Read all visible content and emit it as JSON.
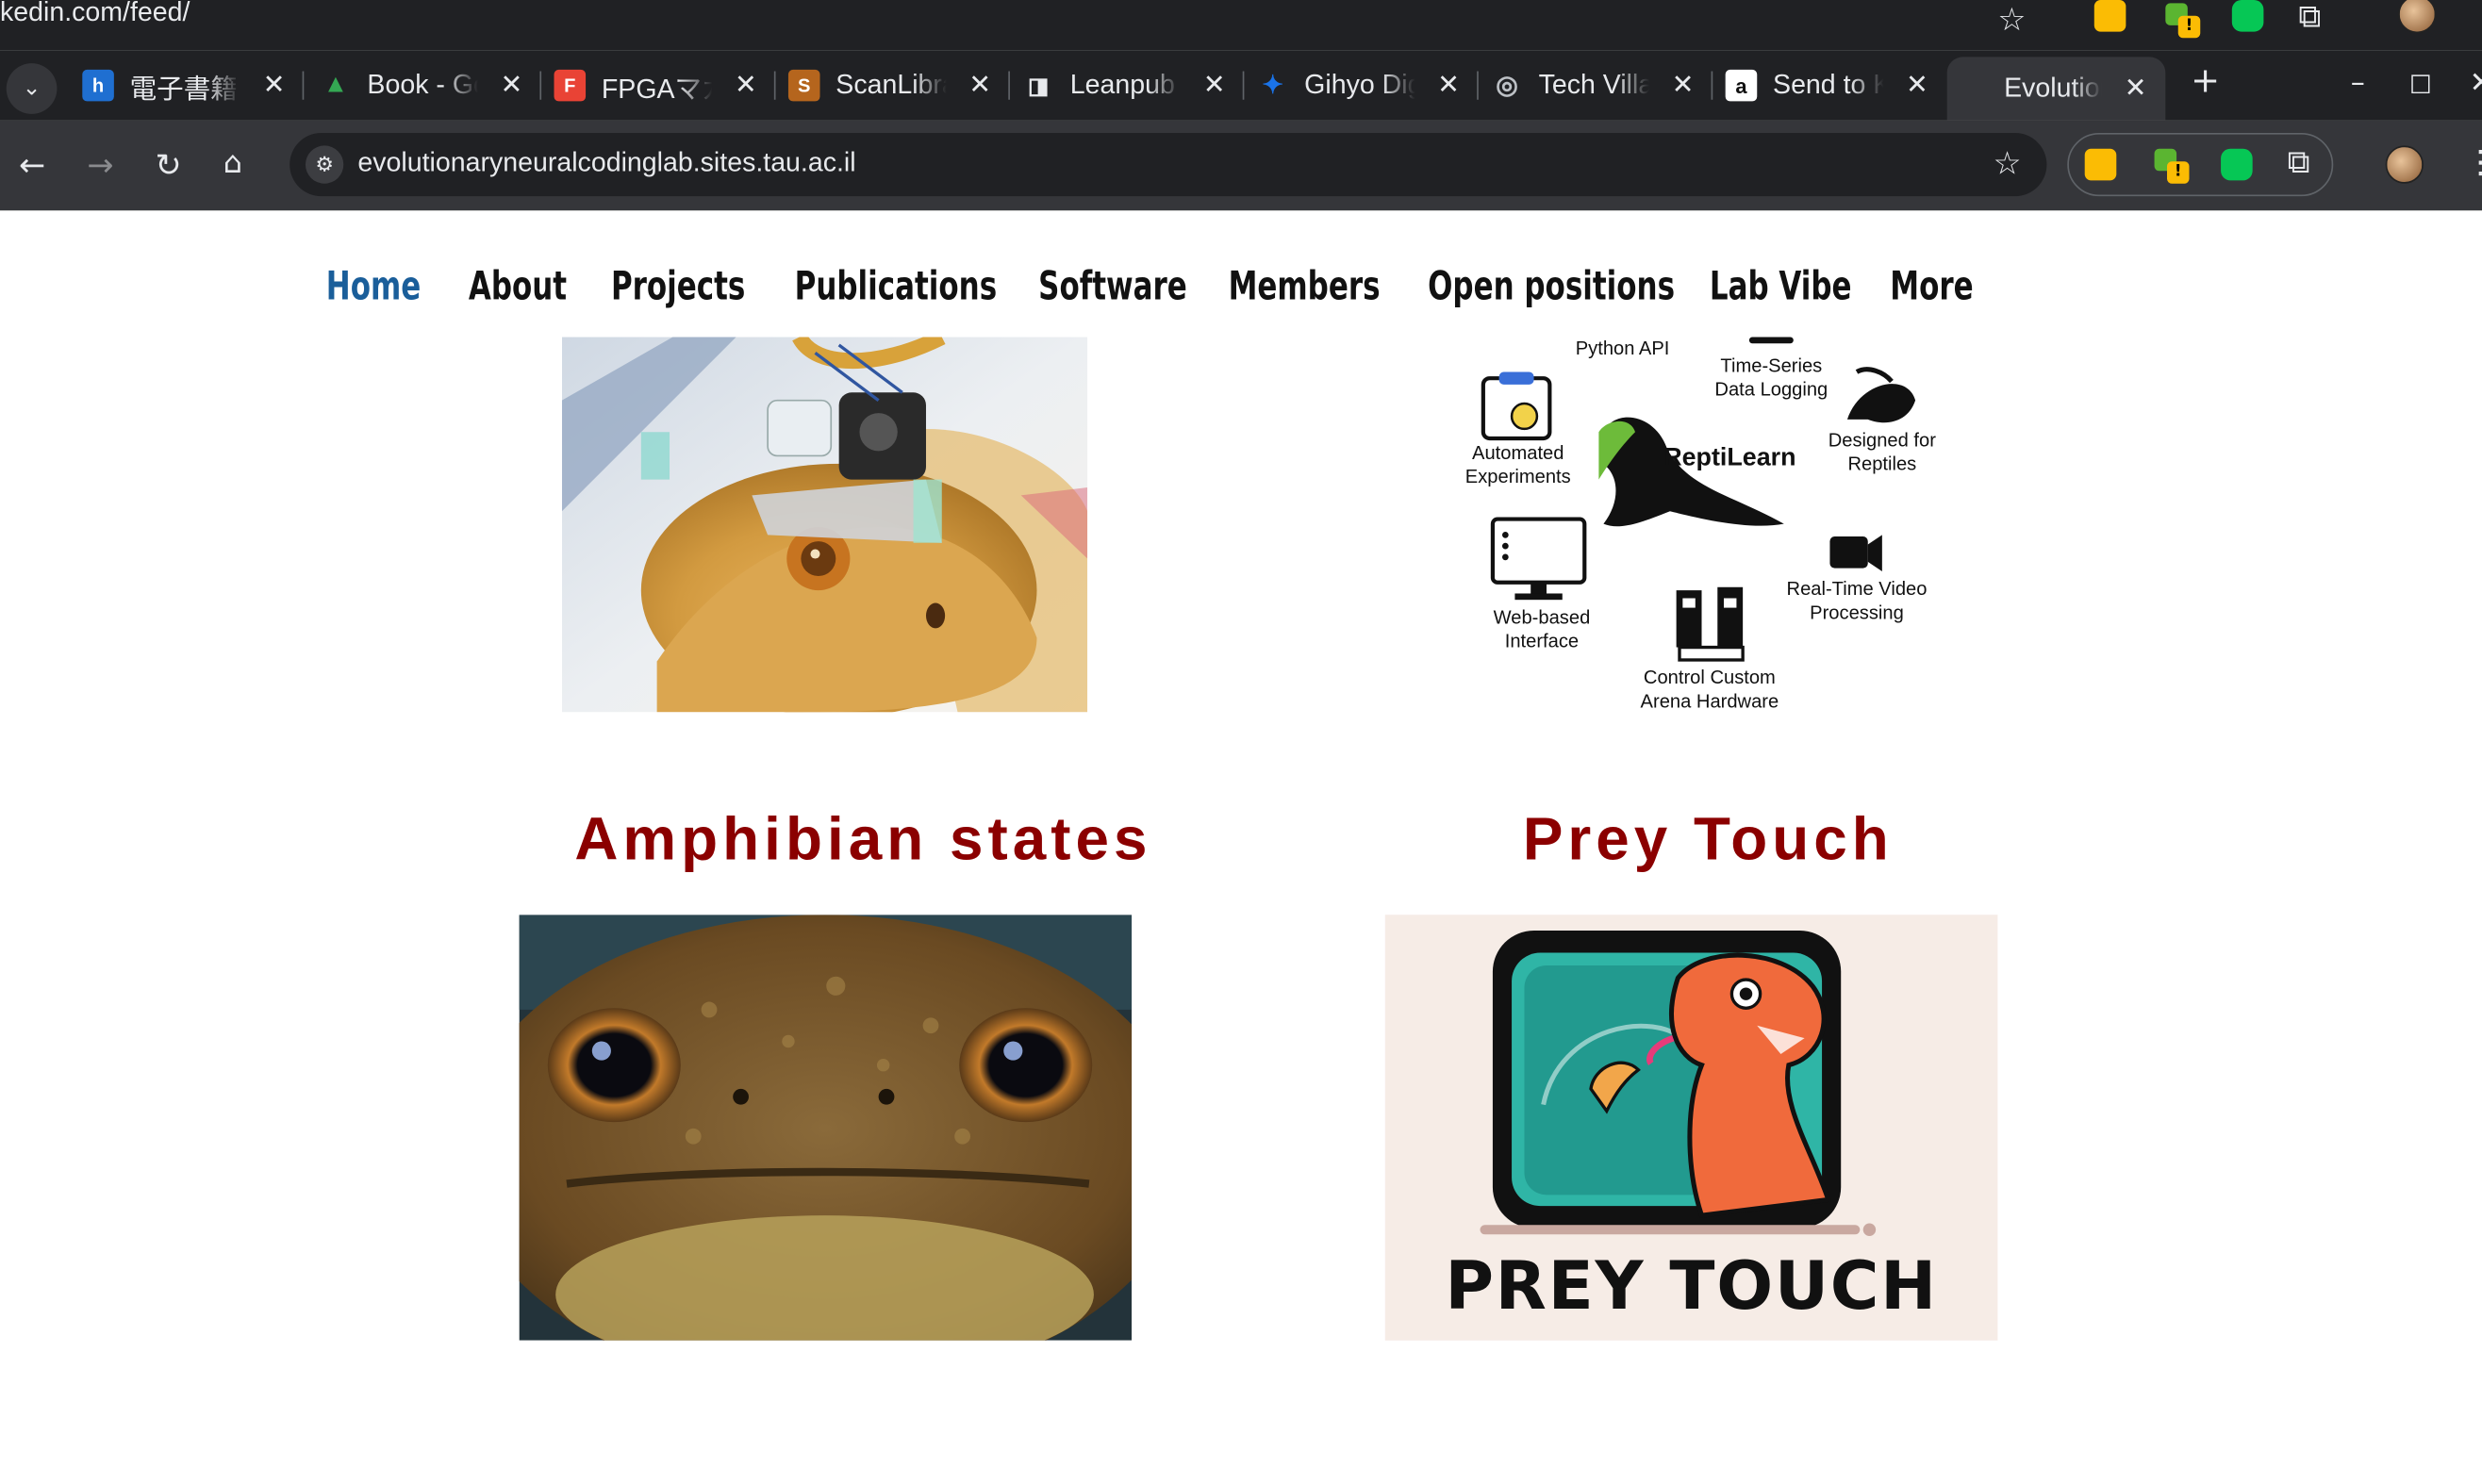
{
  "browser": {
    "prev_url": "kedin.com/feed/",
    "tabs": [
      {
        "title": "電子書籍",
        "favicon": "hatena-icon",
        "color": "#1f6fd1",
        "glyph": "h"
      },
      {
        "title": "Book - Google Drive",
        "favicon": "drive-icon",
        "color": "#34a853",
        "glyph": "▲"
      },
      {
        "title": "FPGAマガジン",
        "favicon": "fpga-icon",
        "color": "#e94335",
        "glyph": "F"
      },
      {
        "title": "ScanLibrary",
        "favicon": "scanlib-icon",
        "color": "#b5651d",
        "glyph": "S"
      },
      {
        "title": "Leanpub",
        "favicon": "leanpub-icon",
        "color": "#202124",
        "glyph": "◨"
      },
      {
        "title": "Gihyo Digital",
        "favicon": "gihyo-icon",
        "color": "#1a73e8",
        "glyph": "✦"
      },
      {
        "title": "Tech Village",
        "favicon": "globe-icon",
        "color": "#5f6368",
        "glyph": "◎"
      },
      {
        "title": "Send to Kindle",
        "favicon": "amazon-icon",
        "color": "#ffffff",
        "glyph": "a"
      },
      {
        "title": "Evolutionary Neural Coding Lab",
        "favicon": "none",
        "color": "#35363a",
        "glyph": ""
      }
    ],
    "url": "evolutionaryneuralcodinglab.sites.tau.ac.il"
  },
  "site": {
    "menu": [
      "Home",
      "About",
      "Projects",
      "Publications",
      "Software",
      "Members",
      "Open positions",
      "Lab Vibe",
      "More"
    ],
    "reptilearn": {
      "logo_text": "ReptiLearn",
      "features": [
        "Python API",
        "Time-Series Data Logging",
        "Automated Experiments",
        "Designed for Reptiles",
        "Web-based Interface",
        "Real-Time Video Processing",
        "Control Custom Arena Hardware"
      ]
    },
    "projects": [
      {
        "title": "Amphibian states"
      },
      {
        "title": "Prey Touch",
        "image_text": "PREY TOUCH"
      }
    ]
  }
}
